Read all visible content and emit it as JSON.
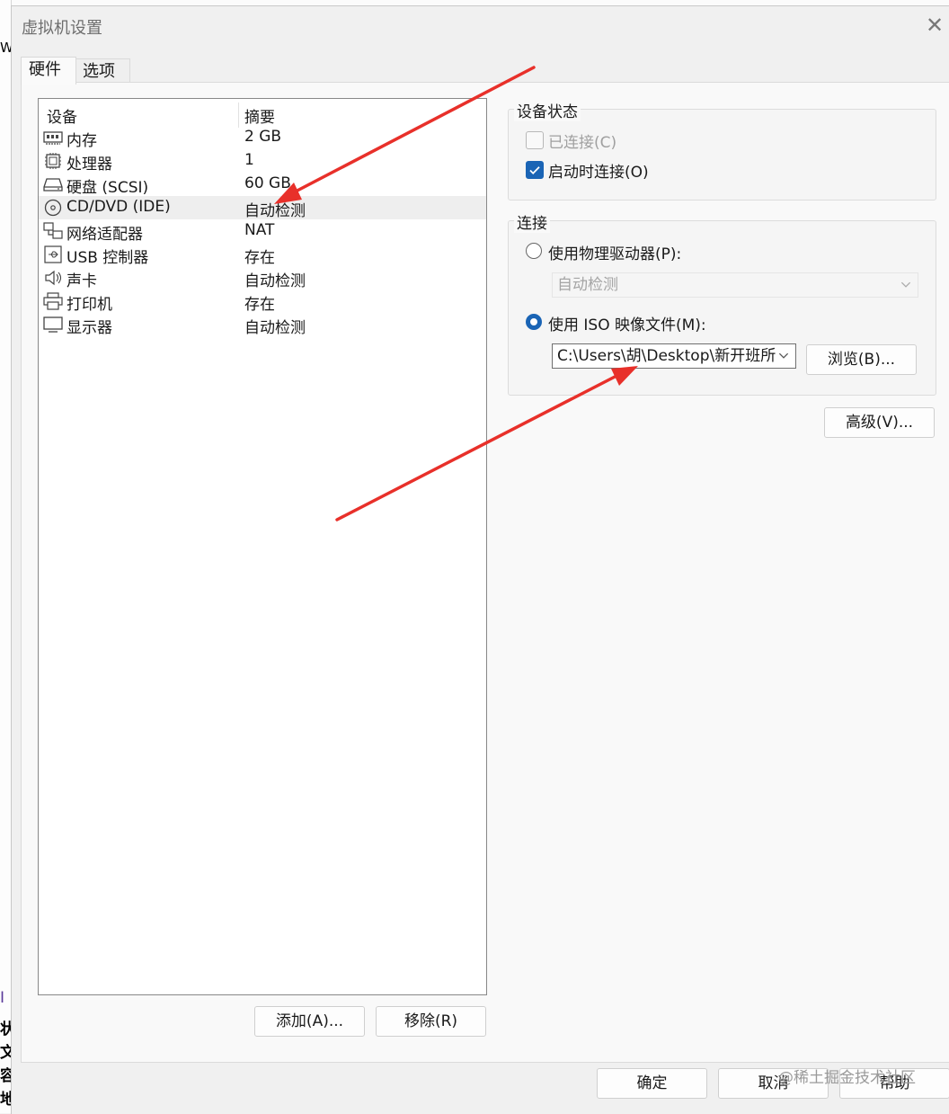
{
  "window": {
    "title": "虚拟机设置",
    "close_glyph": "✕"
  },
  "background": {
    "left_chars": [
      "W",
      "I",
      "状",
      "文",
      "容",
      "地"
    ]
  },
  "tabs": [
    {
      "label": "硬件"
    },
    {
      "label": "选项"
    }
  ],
  "device_list": {
    "columns": {
      "device": "设备",
      "summary": "摘要"
    },
    "rows": [
      {
        "icon": "memory-icon",
        "device": "内存",
        "summary": "2 GB"
      },
      {
        "icon": "processor-icon",
        "device": "处理器",
        "summary": "1"
      },
      {
        "icon": "hard-disk-icon",
        "device": "硬盘 (SCSI)",
        "summary": "60 GB"
      },
      {
        "icon": "cd-dvd-icon",
        "device": "CD/DVD (IDE)",
        "summary": "自动检测",
        "selected": true
      },
      {
        "icon": "network-adapter-icon",
        "device": "网络适配器",
        "summary": "NAT"
      },
      {
        "icon": "usb-icon",
        "device": "USB 控制器",
        "summary": "存在"
      },
      {
        "icon": "sound-card-icon",
        "device": "声卡",
        "summary": "自动检测"
      },
      {
        "icon": "printer-icon",
        "device": "打印机",
        "summary": "存在"
      },
      {
        "icon": "display-icon",
        "device": "显示器",
        "summary": "自动检测"
      }
    ]
  },
  "list_buttons": {
    "add": "添加(A)...",
    "remove": "移除(R)"
  },
  "device_status": {
    "title": "设备状态",
    "connected": {
      "label": "已连接(C)",
      "checked": false,
      "enabled": false
    },
    "connect_at_power_on": {
      "label": "启动时连接(O)",
      "checked": true
    }
  },
  "connection": {
    "title": "连接",
    "physical": {
      "label": "使用物理驱动器(P):",
      "selected": false
    },
    "physical_select": {
      "value": "自动检测"
    },
    "iso": {
      "label": "使用 ISO 映像文件(M):",
      "selected": true
    },
    "iso_select": {
      "value": "C:\\Users\\胡\\Desktop\\新开班所"
    },
    "browse": "浏览(B)..."
  },
  "advanced_button": "高级(V)...",
  "footer": {
    "ok": "确定",
    "cancel": "取消",
    "help": "帮助"
  },
  "watermark": "@稀土掘金技术社区",
  "annotation_color": "#e8302a",
  "accent_color": "#1a64b5"
}
